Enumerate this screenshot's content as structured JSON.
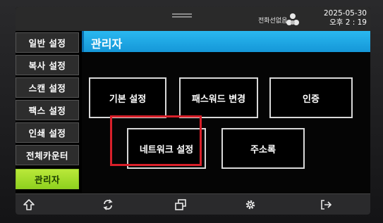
{
  "statusbar": {
    "connection_text": "전화선없음",
    "date": "2025-05-30",
    "time": "오후 2 : 19"
  },
  "sidebar": {
    "items": [
      {
        "label": "일반 설정"
      },
      {
        "label": "복사 설정"
      },
      {
        "label": "스캔 설정"
      },
      {
        "label": "팩스 설정"
      },
      {
        "label": "인쇄 설정"
      },
      {
        "label": "전체카운터"
      },
      {
        "label": "관리자",
        "active": true
      }
    ]
  },
  "main": {
    "title": "관리자",
    "buttons": [
      {
        "label": "기본 설정"
      },
      {
        "label": "패스워드 변경"
      },
      {
        "label": "인증"
      },
      {
        "label": "네트워크 설정",
        "highlighted": true
      },
      {
        "label": "주소록"
      }
    ]
  },
  "bottombar": {
    "icons": [
      "home-icon",
      "refresh-icon",
      "copy-windows-icon",
      "gear-icon",
      "logout-icon"
    ]
  },
  "colors": {
    "title_bar": "#1fa8e6",
    "active_tab": "#a6de2c",
    "highlight": "#d8202a"
  }
}
